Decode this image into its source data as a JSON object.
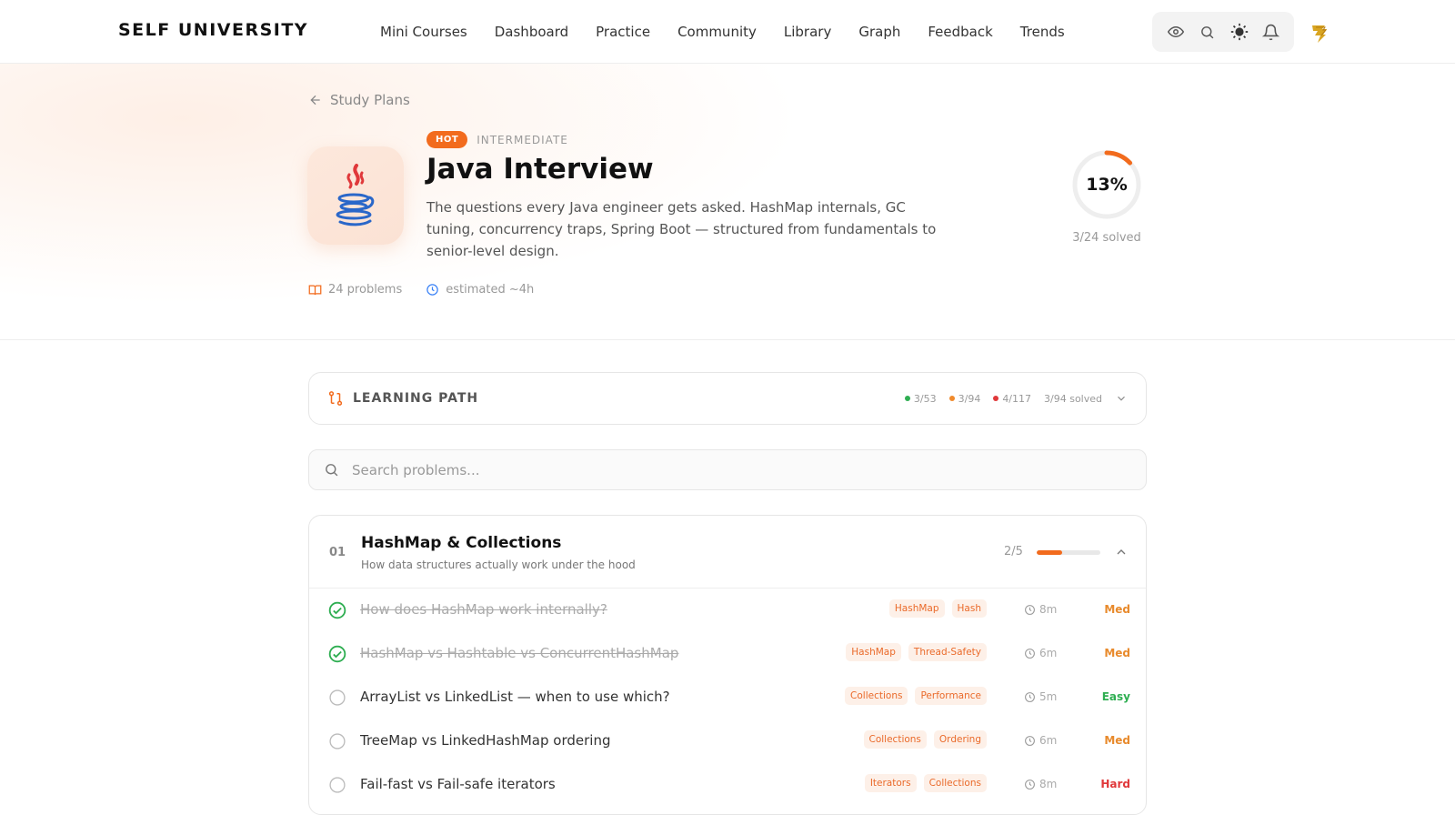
{
  "brand": "SELF UNIVERSITY",
  "nav": [
    "Mini Courses",
    "Dashboard",
    "Practice",
    "Community",
    "Library",
    "Graph",
    "Feedback",
    "Trends"
  ],
  "breadcrumb": {
    "label": "Study Plans"
  },
  "course": {
    "hot_badge": "HOT",
    "level": "INTERMEDIATE",
    "title": "Java Interview",
    "description": "The questions every Java engineer gets asked. HashMap internals, GC tuning, concurrency traps, Spring Boot — structured from fundamentals to senior-level design.",
    "problems": "24 problems",
    "estimate": "estimated ~4h",
    "progress_percent": 13,
    "progress_label": "13%",
    "solved": "3/24 solved"
  },
  "learning_path": {
    "title": "LEARNING PATH",
    "stats": [
      {
        "value": "3/53",
        "color": "#2fae52"
      },
      {
        "value": "3/94",
        "color": "#f08a2c"
      },
      {
        "value": "4/117",
        "color": "#e0383a"
      }
    ],
    "solved": "3/94 solved"
  },
  "search": {
    "placeholder": "Search problems..."
  },
  "section": {
    "number": "01",
    "title": "HashMap & Collections",
    "subtitle": "How data structures actually work under the hood",
    "count": "2/5",
    "progress_fraction": 0.4,
    "problems": [
      {
        "question": "How does HashMap work internally?",
        "tags": [
          "HashMap",
          "Hash"
        ],
        "time": "8m",
        "difficulty": "Med",
        "level": "med",
        "done": true
      },
      {
        "question": "HashMap vs Hashtable vs ConcurrentHashMap",
        "tags": [
          "HashMap",
          "Thread-Safety"
        ],
        "time": "6m",
        "difficulty": "Med",
        "level": "med",
        "done": true
      },
      {
        "question": "ArrayList vs LinkedList — when to use which?",
        "tags": [
          "Collections",
          "Performance"
        ],
        "time": "5m",
        "difficulty": "Easy",
        "level": "easy",
        "done": false
      },
      {
        "question": "TreeMap vs LinkedHashMap ordering",
        "tags": [
          "Collections",
          "Ordering"
        ],
        "time": "6m",
        "difficulty": "Med",
        "level": "med",
        "done": false
      },
      {
        "question": "Fail-fast vs Fail-safe iterators",
        "tags": [
          "Iterators",
          "Collections"
        ],
        "time": "8m",
        "difficulty": "Hard",
        "level": "hard",
        "done": false
      }
    ]
  },
  "colors": {
    "accent": "#f26b1d",
    "success": "#2fae52",
    "medium": "#e88a2c",
    "hard": "#e0383a"
  }
}
